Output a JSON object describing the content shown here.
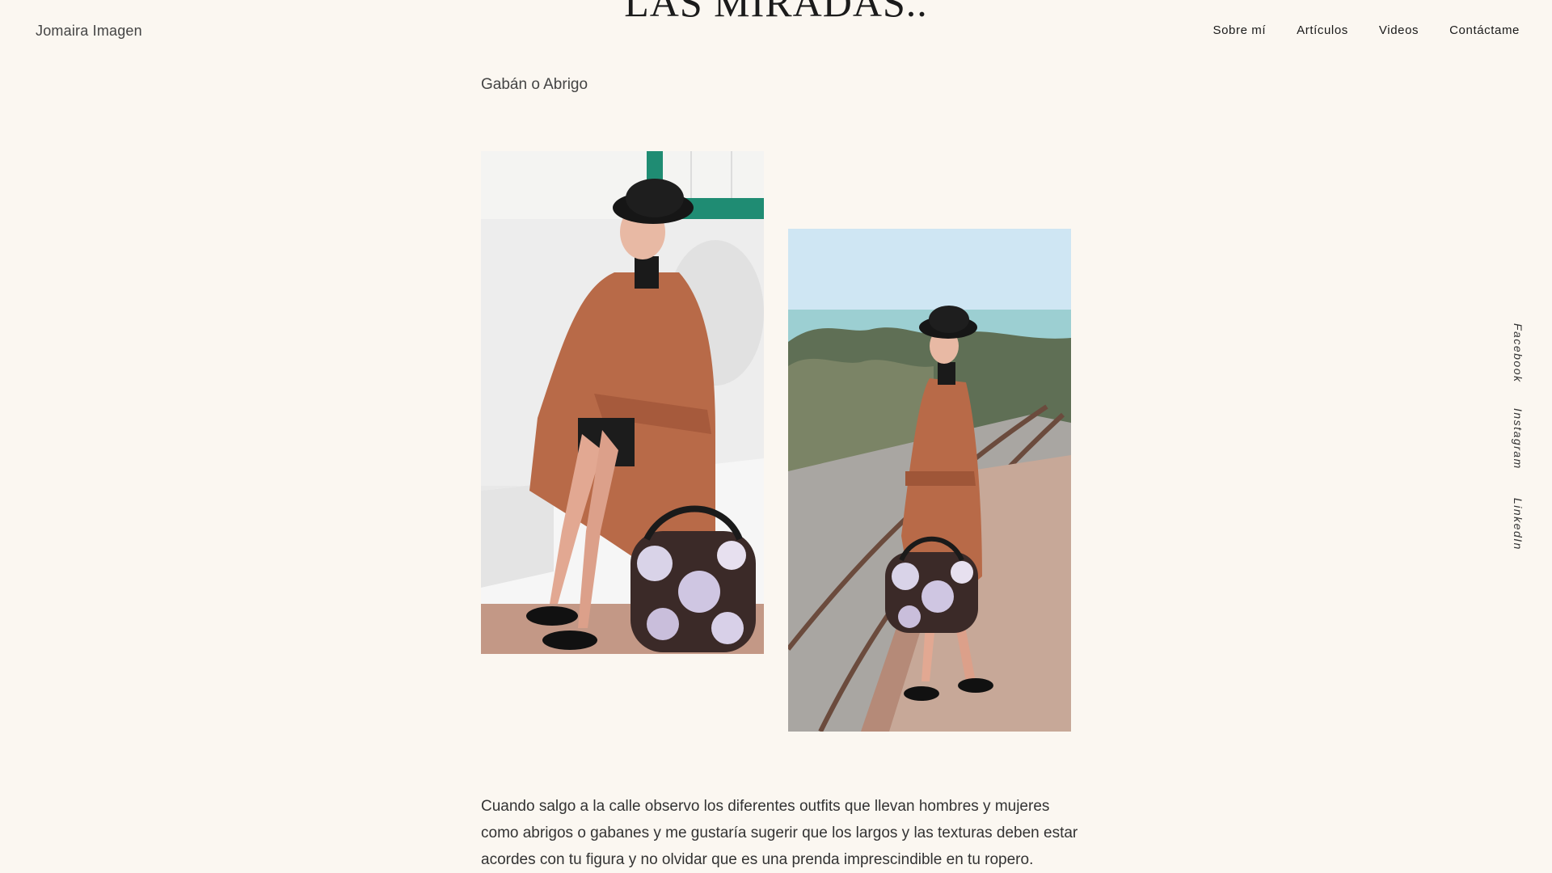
{
  "header": {
    "site_title": "Jomaira Imagen",
    "page_heading": "LAS MIRADAS.."
  },
  "nav": {
    "items": [
      {
        "label": "Sobre mí"
      },
      {
        "label": "Artículos"
      },
      {
        "label": "Videos"
      },
      {
        "label": "Contáctame"
      }
    ]
  },
  "social": {
    "items": [
      {
        "label": "Facebook"
      },
      {
        "label": "Instagram"
      },
      {
        "label": "LinkedIn"
      }
    ]
  },
  "article": {
    "subtitle": "Gabán o Abrigo",
    "body": "Cuando salgo a la calle observo los diferentes outfits que llevan hombres y mujeres como abrigos o gabanes y me gustaría sugerir que los largos y las texturas deben estar acordes con tu figura y no olvidar que es una prenda imprescindible en tu ropero."
  },
  "colors": {
    "background": "#fbf7f1",
    "coat": "#b86a48",
    "hat": "#1a1a1a",
    "tile_accent": "#1f8c73"
  }
}
